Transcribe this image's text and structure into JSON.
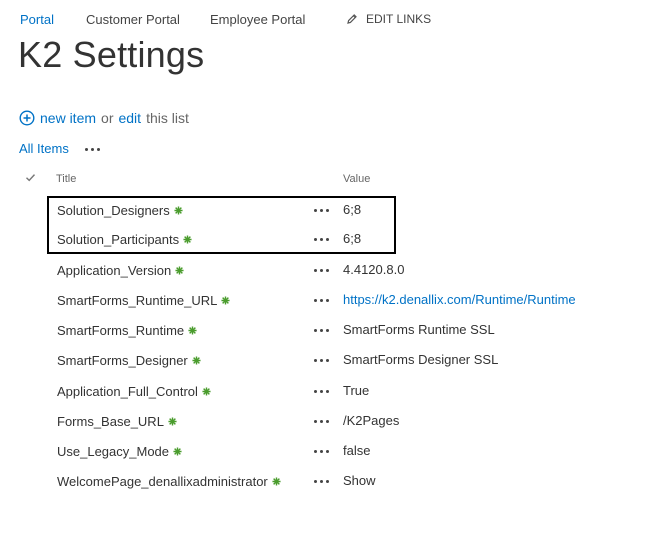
{
  "topnav": {
    "items": [
      "Portal",
      "Customer Portal",
      "Employee Portal"
    ],
    "edit_links": "EDIT LINKS"
  },
  "page": {
    "title": "K2 Settings"
  },
  "toolbar": {
    "new_item": "new item",
    "or": "or",
    "edit": "edit",
    "this_list": "this list"
  },
  "views": {
    "current": "All Items"
  },
  "list": {
    "columns": {
      "title": "Title",
      "value": "Value"
    },
    "rows": [
      {
        "title": "Solution_Designers",
        "value": "6;8",
        "is_link": false
      },
      {
        "title": "Solution_Participants",
        "value": "6;8",
        "is_link": false
      },
      {
        "title": "Application_Version",
        "value": "4.4120.8.0",
        "is_link": false
      },
      {
        "title": "SmartForms_Runtime_URL",
        "value": "https://k2.denallix.com/Runtime/Runtime",
        "is_link": true
      },
      {
        "title": "SmartForms_Runtime",
        "value": "SmartForms Runtime SSL",
        "is_link": false
      },
      {
        "title": "SmartForms_Designer",
        "value": "SmartForms Designer SSL",
        "is_link": false
      },
      {
        "title": "Application_Full_Control",
        "value": "True",
        "is_link": false
      },
      {
        "title": "Forms_Base_URL",
        "value": "/K2Pages",
        "is_link": false
      },
      {
        "title": "Use_Legacy_Mode",
        "value": "false",
        "is_link": false
      },
      {
        "title": "WelcomePage_denallixadministrator",
        "value": "Show",
        "is_link": false
      }
    ]
  },
  "colors": {
    "link": "#0072c6",
    "new_badge": "#4a9c2d",
    "text": "#333333"
  }
}
